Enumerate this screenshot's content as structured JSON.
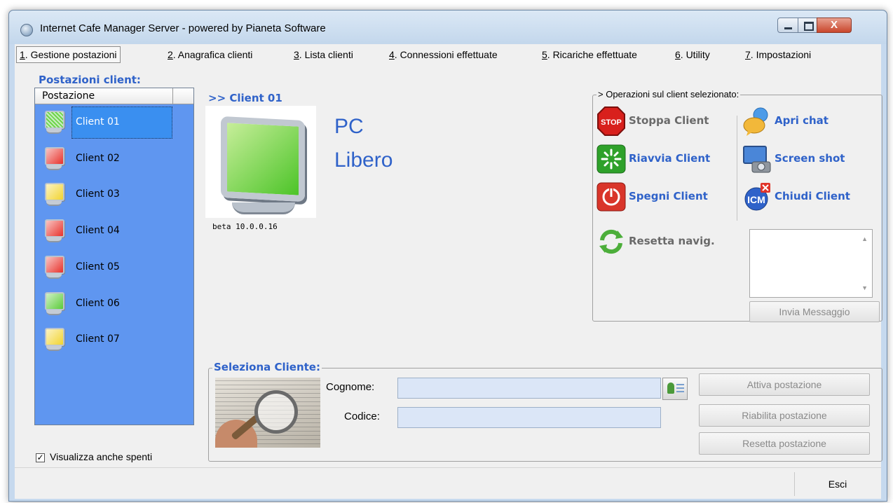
{
  "window": {
    "title": "Internet Cafe Manager Server - powered by Pianeta Software",
    "close_glyph": "X"
  },
  "menu": [
    {
      "key": "1",
      "label": ". Gestione postazioni"
    },
    {
      "key": "2",
      "label": ". Anagrafica clienti"
    },
    {
      "key": "3",
      "label": ". Lista clienti"
    },
    {
      "key": "4",
      "label": ". Connessioni effettuate"
    },
    {
      "key": "5",
      "label": ". Ricariche effettuate"
    },
    {
      "key": "6",
      "label": ". Utility"
    },
    {
      "key": "7",
      "label": ". Impostazioni"
    }
  ],
  "clients_panel": {
    "title": "Postazioni client:",
    "column_header": "Postazione",
    "list_bg": "#5f96f0",
    "items": [
      {
        "label": "Client 01",
        "status": "green-striped",
        "color": "#6fd44a"
      },
      {
        "label": "Client 02",
        "status": "red",
        "color": "#e8322b"
      },
      {
        "label": "Client 03",
        "status": "yellow",
        "color": "#f2d430"
      },
      {
        "label": "Client 04",
        "status": "red",
        "color": "#e8322b"
      },
      {
        "label": "Client 05",
        "status": "red",
        "color": "#e8322b"
      },
      {
        "label": "Client 06",
        "status": "green",
        "color": "#5ccc3a"
      },
      {
        "label": "Client 07",
        "status": "yellow",
        "color": "#f2d430"
      }
    ],
    "show_off_label": "Visualizza anche spenti",
    "show_off_checked": "✓"
  },
  "selected": {
    "header": ">> Client 01",
    "ip": "beta 10.0.0.16",
    "status_line1": "PC",
    "status_line2": "Libero"
  },
  "operations": {
    "legend": "> Operazioni sul client selezionato:",
    "stop": "Stoppa Client",
    "stop_icon_text": "STOP",
    "restart": "Riavvia Client",
    "shutdown": "Spegni Client",
    "reset_nav": "Resetta navig.",
    "chat": "Apri chat",
    "screenshot": "Screen shot",
    "close_client": "Chiudi Client",
    "close_icon_text": "ICM",
    "send_message": "Invia Messaggio",
    "scroll_up": "▲",
    "scroll_down": "▼"
  },
  "select_customer": {
    "legend": "Seleziona Cliente:",
    "surname_label": "Cognome:",
    "surname_value": "",
    "code_label": "Codice:",
    "code_value": "",
    "activate": "Attiva postazione",
    "reenable": "Riabilita postazione",
    "reset": "Resetta postazione"
  },
  "footer": {
    "exit": "Esci"
  },
  "colors": {
    "accent": "#2f62c9",
    "field_bg": "#dbe6f7"
  }
}
